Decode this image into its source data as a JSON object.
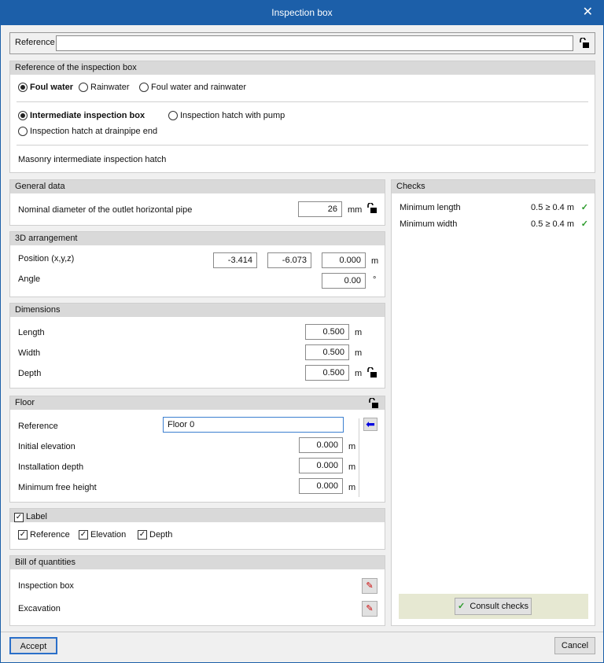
{
  "window": {
    "title": "Inspection box"
  },
  "reference": {
    "label": "Reference",
    "value": ""
  },
  "type_section": {
    "title": "Reference of the inspection box",
    "water_options": [
      {
        "label": "Foul water",
        "selected": true
      },
      {
        "label": "Rainwater",
        "selected": false
      },
      {
        "label": "Foul water and rainwater",
        "selected": false
      }
    ],
    "box_options": [
      {
        "label": "Intermediate inspection box",
        "selected": true
      },
      {
        "label": "Inspection hatch with pump",
        "selected": false
      },
      {
        "label": "Inspection hatch at drainpipe end",
        "selected": false
      }
    ],
    "description": "Masonry intermediate inspection hatch"
  },
  "general": {
    "title": "General data",
    "diameter_label": "Nominal diameter of the outlet horizontal pipe",
    "diameter_value": "26",
    "diameter_unit": "mm"
  },
  "arrangement": {
    "title": "3D arrangement",
    "position_label": "Position (x,y,z)",
    "x": "-3.414",
    "y": "-6.073",
    "z": "0.000",
    "position_unit": "m",
    "angle_label": "Angle",
    "angle_value": "0.00",
    "angle_unit": "°"
  },
  "dimensions": {
    "title": "Dimensions",
    "rows": [
      {
        "label": "Length",
        "value": "0.500",
        "unit": "m"
      },
      {
        "label": "Width",
        "value": "0.500",
        "unit": "m"
      },
      {
        "label": "Depth",
        "value": "0.500",
        "unit": "m"
      }
    ]
  },
  "floor": {
    "title": "Floor",
    "reference_label": "Reference",
    "reference_value": "Floor 0",
    "rows": [
      {
        "label": "Initial elevation",
        "value": "0.000",
        "unit": "m"
      },
      {
        "label": "Installation depth",
        "value": "0.000",
        "unit": "m"
      },
      {
        "label": "Minimum free height",
        "value": "0.000",
        "unit": "m"
      }
    ]
  },
  "label": {
    "title": "Label",
    "checked": true,
    "options": [
      {
        "label": "Reference",
        "checked": true
      },
      {
        "label": "Elevation",
        "checked": true
      },
      {
        "label": "Depth",
        "checked": true
      }
    ]
  },
  "bill": {
    "title": "Bill of quantities",
    "rows": [
      {
        "label": "Inspection box"
      },
      {
        "label": "Excavation"
      }
    ]
  },
  "checks": {
    "title": "Checks",
    "rows": [
      {
        "label": "Minimum length",
        "value": "0.5 ≥ 0.4  m",
        "ok": true
      },
      {
        "label": "Minimum width",
        "value": "0.5 ≥ 0.4  m",
        "ok": true
      }
    ],
    "consult_label": "Consult checks"
  },
  "footer": {
    "accept": "Accept",
    "cancel": "Cancel"
  },
  "colors": {
    "titlebar": "#1c5fa9",
    "check": "#2a9a2a",
    "checks_footer": "#e6e8d2"
  }
}
